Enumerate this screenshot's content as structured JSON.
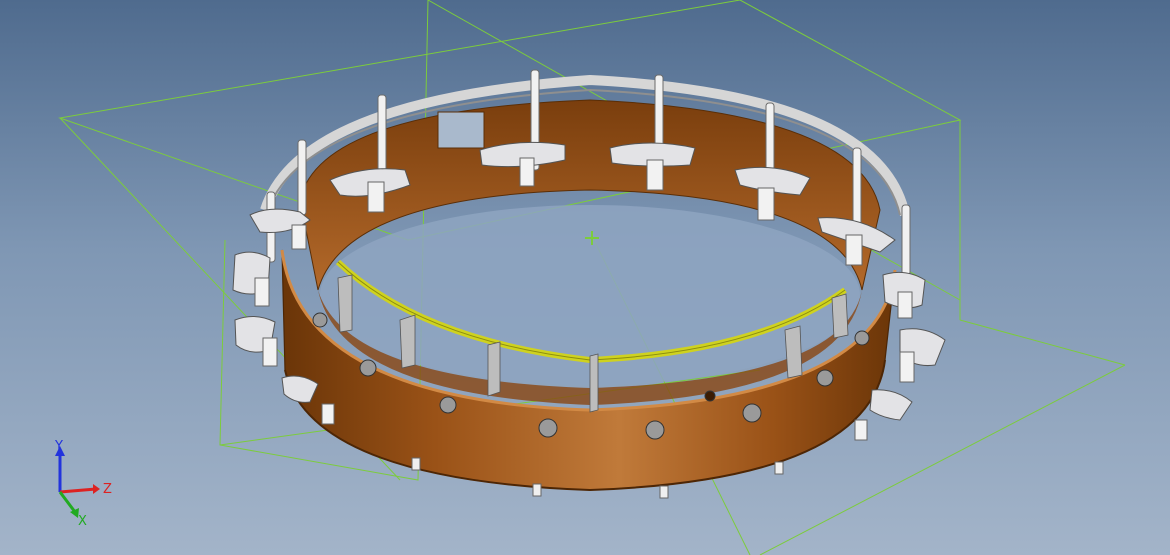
{
  "viewport": {
    "background_top": "#4f6b8e",
    "background_bottom": "#a3b4c9"
  },
  "model": {
    "part": "banjo-rim-assembly",
    "wood_color": "#a55a1a",
    "hardware_color": "#e3e3e6",
    "tension_hoop_color": "#c6c6c6",
    "tone_ring_color": "#cfd21f",
    "reference_plane_color": "#7ccc3c",
    "bracket_count_visible": 19,
    "screw_count_visible": 11
  },
  "triad": {
    "y_label": "Y",
    "z_label": "Z",
    "x_label": "X",
    "y_color": "#2233dd",
    "z_color": "#dd2222",
    "x_color": "#22aa22"
  }
}
